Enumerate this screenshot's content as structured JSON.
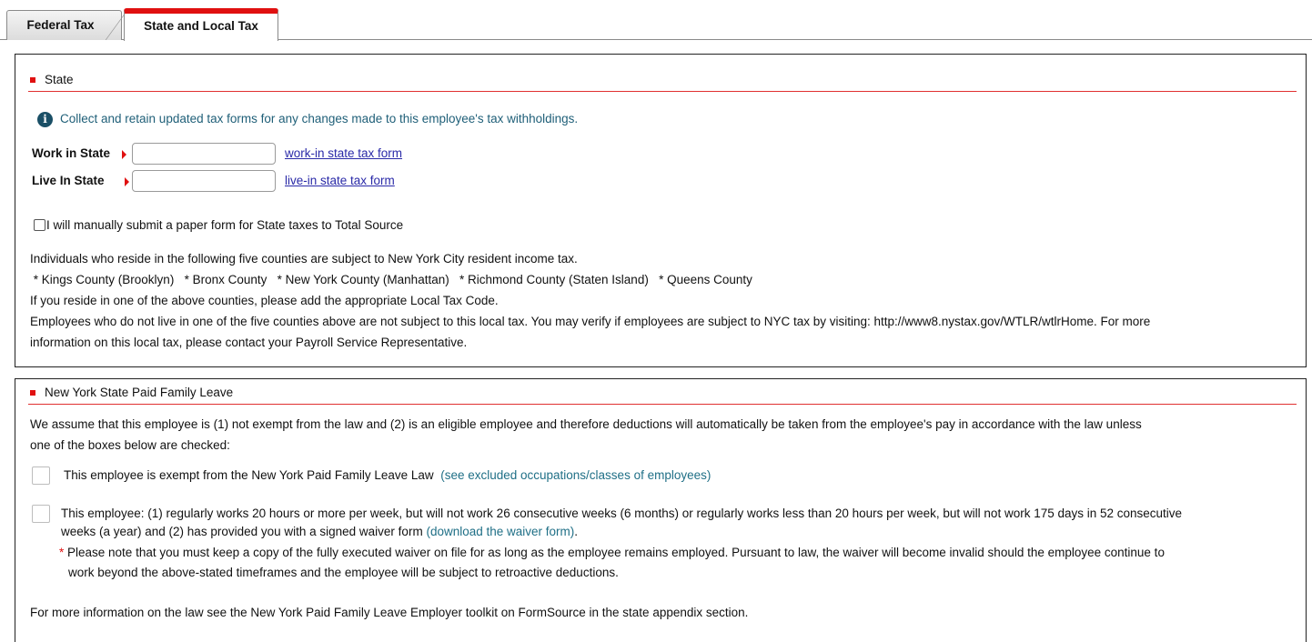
{
  "tabs": [
    {
      "label": "Federal Tax",
      "active": false
    },
    {
      "label": "State and Local Tax",
      "active": true
    }
  ],
  "state_section": {
    "title": "State",
    "info_message": "Collect and retain updated tax forms for any changes made to this employee's tax withholdings.",
    "work_in_state": {
      "label": "Work in State",
      "value": "",
      "link": "work-in state tax form"
    },
    "live_in_state": {
      "label": "Live In State",
      "value": "",
      "link": "live-in state tax form"
    },
    "manual_submit_checkbox": {
      "label": "I will manually submit a paper form for State taxes to Total Source",
      "checked": false
    },
    "nyc_text": {
      "line1": "Individuals who reside in the following five counties are subject to New York City resident income tax.",
      "counties_line": " * Kings County (Brooklyn)   * Bronx County   * New York County (Manhattan)   * Richmond County (Staten Island)   * Queens County",
      "line3": "If you reside in one of the above counties, please add the appropriate Local Tax Code.",
      "line4": "Employees who do not live in one of the five counties above are not subject to this local tax. You may verify if employees are subject to NYC tax by visiting: http://www8.nystax.gov/WTLR/wtlrHome. For more",
      "line5": "information on this local tax, please contact your Payroll Service Representative."
    }
  },
  "pfl_section": {
    "title": "New York State Paid Family Leave",
    "intro_line1": "We assume that this employee is (1) not exempt from the law and (2) is an eligible employee and therefore deductions will automatically be taken from the employee's pay in accordance with the law unless",
    "intro_line2": "one of the boxes below are checked:",
    "exempt_option": {
      "text": "This employee is exempt from the New York Paid Family Leave Law",
      "link": "(see excluded occupations/classes of employees)",
      "checked": false
    },
    "waiver_option": {
      "line1": "This employee: (1) regularly works 20 hours or more per week, but will not work 26 consecutive weeks (6 months) or regularly works less than 20 hours per week, but will not work 175 days in 52 consecutive",
      "line2": "weeks (a year) and (2) has provided you with a signed waiver form",
      "link": "(download the waiver form)",
      "line2_end": ".",
      "checked": false
    },
    "note_star": "*",
    "note_line1": " Please note that you must keep a copy of the fully executed waiver on file for as long as the employee remains employed.  Pursuant to law, the waiver will become invalid should the employee continue to",
    "note_line2": "work beyond the above-stated timeframes and the employee will be subject to retroactive deductions.",
    "footer": "For more information on the law see the New York Paid Family Leave Employer toolkit on FormSource in the state appendix section."
  },
  "colors": {
    "accent_red": "#e01010",
    "info_teal": "#1f5f78",
    "link_blue": "#2a2aa8"
  }
}
